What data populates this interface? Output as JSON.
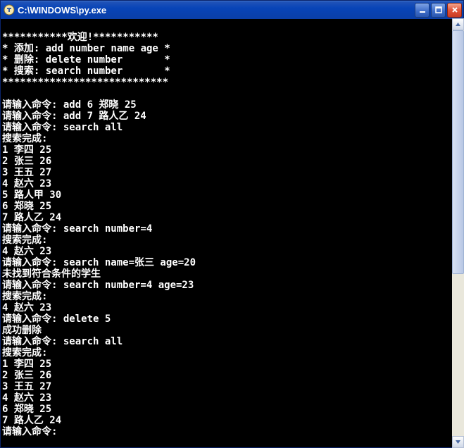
{
  "window": {
    "title": "C:\\WINDOWS\\py.exe"
  },
  "console": {
    "lines": [
      "",
      "***********欢迎!***********",
      "* 添加: add number name age *",
      "* 删除: delete number       *",
      "* 搜索: search number       *",
      "****************************",
      "",
      "请输入命令: add 6 郑晓 25",
      "请输入命令: add 7 路人乙 24",
      "请输入命令: search all",
      "搜索完成:",
      "1 李四 25",
      "2 张三 26",
      "3 王五 27",
      "4 赵六 23",
      "5 路人甲 30",
      "6 郑晓 25",
      "7 路人乙 24",
      "请输入命令: search number=4",
      "搜索完成:",
      "4 赵六 23",
      "请输入命令: search name=张三 age=20",
      "未找到符合条件的学生",
      "请输入命令: search number=4 age=23",
      "搜索完成:",
      "4 赵六 23",
      "请输入命令: delete 5",
      "成功删除",
      "请输入命令: search all",
      "搜索完成:",
      "1 李四 25",
      "2 张三 26",
      "3 王五 27",
      "4 赵六 23",
      "6 郑晓 25",
      "7 路人乙 24",
      "请输入命令:"
    ]
  }
}
